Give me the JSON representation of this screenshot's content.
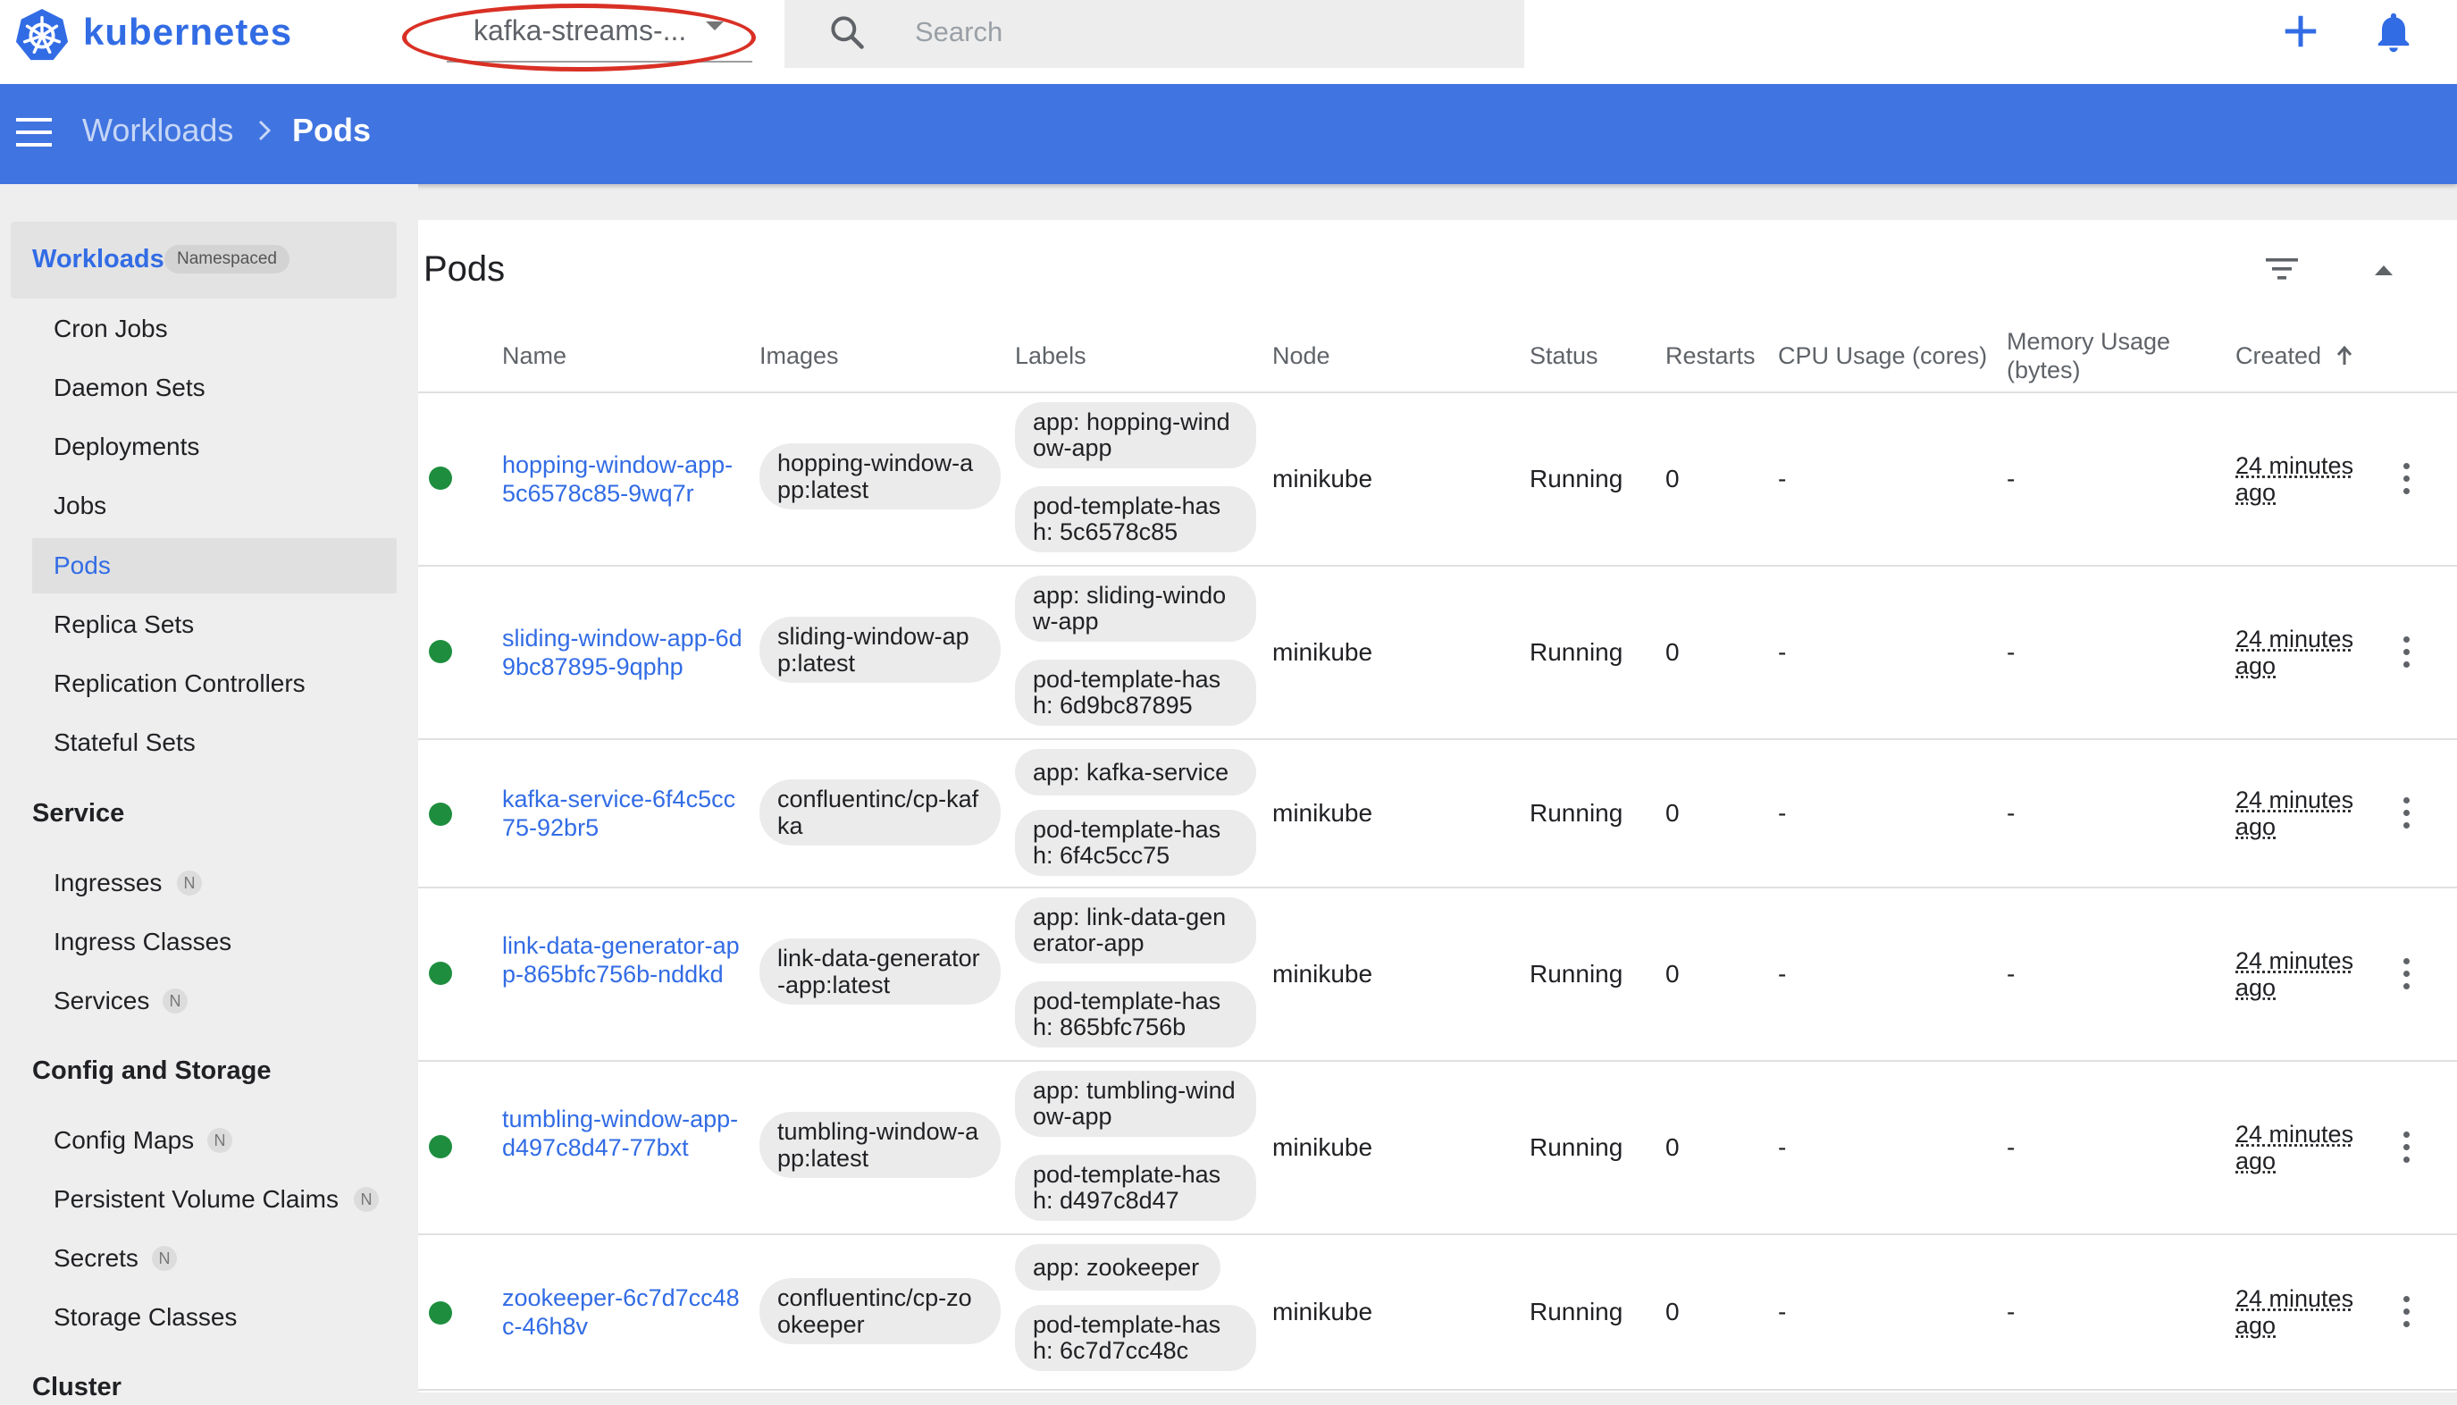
{
  "app": {
    "brand": "kubernetes"
  },
  "topbar": {
    "namespace_value": "kafka-streams-...",
    "search_placeholder": "Search"
  },
  "breadcrumb": {
    "parent": "Workloads",
    "current": "Pods"
  },
  "sidebar": {
    "workloads_label": "Workloads",
    "namespaced_badge": "Namespaced",
    "workload_items": [
      "Cron Jobs",
      "Daemon Sets",
      "Deployments",
      "Jobs",
      "Pods",
      "Replica Sets",
      "Replication Controllers",
      "Stateful Sets"
    ],
    "active_item": "Pods",
    "service_heading": "Service",
    "service_items": [
      "Ingresses",
      "Ingress Classes",
      "Services"
    ],
    "config_heading": "Config and Storage",
    "config_items": [
      "Config Maps",
      "Persistent Volume Claims",
      "Secrets",
      "Storage Classes"
    ],
    "cluster_heading": "Cluster",
    "namespaced_marker": "N"
  },
  "pods": {
    "title": "Pods",
    "columns": {
      "name": "Name",
      "images": "Images",
      "labels": "Labels",
      "node": "Node",
      "status": "Status",
      "restarts": "Restarts",
      "cpu": "CPU Usage (cores)",
      "memory": "Memory Usage (bytes)",
      "created": "Created"
    },
    "rows": [
      {
        "name": "hopping-window-app-5c6578c85-9wq7r",
        "image": "hopping-window-app:latest",
        "labels": [
          "app: hopping-window-app",
          "pod-template-hash: 5c6578c85"
        ],
        "node": "minikube",
        "status": "Running",
        "restarts": "0",
        "cpu": "-",
        "memory": "-",
        "created": "24 minutes ago"
      },
      {
        "name": "sliding-window-app-6d9bc87895-9qphp",
        "image": "sliding-window-app:latest",
        "labels": [
          "app: sliding-window-app",
          "pod-template-hash: 6d9bc87895"
        ],
        "node": "minikube",
        "status": "Running",
        "restarts": "0",
        "cpu": "-",
        "memory": "-",
        "created": "24 minutes ago"
      },
      {
        "name": "kafka-service-6f4c5cc75-92br5",
        "image": "confluentinc/cp-kafka",
        "labels": [
          "app: kafka-service",
          "pod-template-hash: 6f4c5cc75"
        ],
        "node": "minikube",
        "status": "Running",
        "restarts": "0",
        "cpu": "-",
        "memory": "-",
        "created": "24 minutes ago"
      },
      {
        "name": "link-data-generator-app-865bfc756b-nddkd",
        "image": "link-data-generator-app:latest",
        "labels": [
          "app: link-data-generator-app",
          "pod-template-hash: 865bfc756b"
        ],
        "node": "minikube",
        "status": "Running",
        "restarts": "0",
        "cpu": "-",
        "memory": "-",
        "created": "24 minutes ago"
      },
      {
        "name": "tumbling-window-app-d497c8d47-77bxt",
        "image": "tumbling-window-app:latest",
        "labels": [
          "app: tumbling-window-app",
          "pod-template-hash: d497c8d47"
        ],
        "node": "minikube",
        "status": "Running",
        "restarts": "0",
        "cpu": "-",
        "memory": "-",
        "created": "24 minutes ago"
      },
      {
        "name": "zookeeper-6c7d7cc48c-46h8v",
        "image": "confluentinc/cp-zookeeper",
        "labels": [
          "app: zookeeper",
          "pod-template-hash: 6c7d7cc48c"
        ],
        "node": "minikube",
        "status": "Running",
        "restarts": "0",
        "cpu": "-",
        "memory": "-",
        "created": "24 minutes ago"
      }
    ]
  },
  "colors": {
    "accent": "#326ce5",
    "header": "#4074e0",
    "running": "#1e8e3e",
    "annotation": "#d93025"
  },
  "icons": [
    "kubernetes-logo",
    "chevron-down-icon",
    "search-icon",
    "plus-icon",
    "bell-icon",
    "menu-icon",
    "chevron-right-icon",
    "filter-icon",
    "collapse-icon",
    "arrow-up-icon",
    "more-vert-icon"
  ]
}
